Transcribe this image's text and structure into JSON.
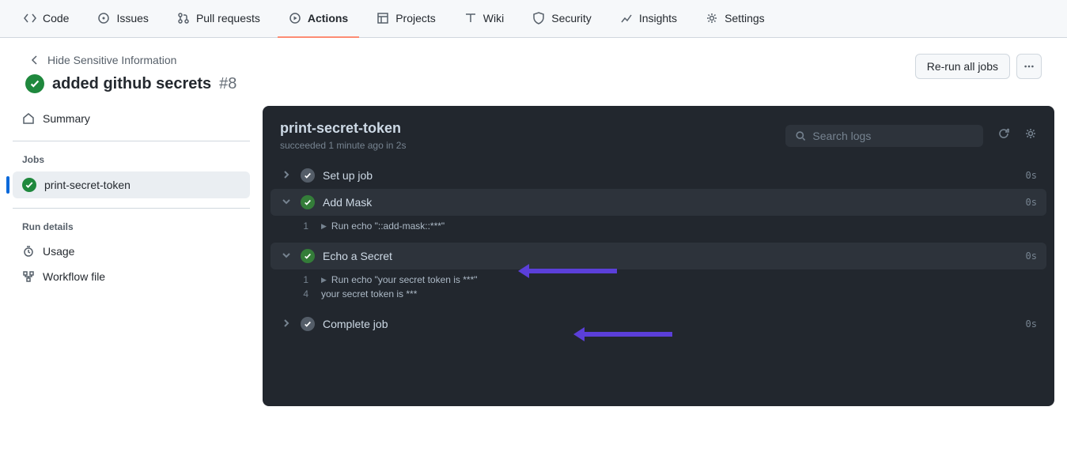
{
  "nav": {
    "items": [
      {
        "label": "Code"
      },
      {
        "label": "Issues"
      },
      {
        "label": "Pull requests"
      },
      {
        "label": "Actions"
      },
      {
        "label": "Projects"
      },
      {
        "label": "Wiki"
      },
      {
        "label": "Security"
      },
      {
        "label": "Insights"
      },
      {
        "label": "Settings"
      }
    ],
    "active_index": 3
  },
  "header": {
    "back_label": "Hide Sensitive Information",
    "run_name": "added github secrets",
    "run_number": "#8",
    "rerun_label": "Re-run all jobs"
  },
  "sidebar": {
    "summary_label": "Summary",
    "jobs_label": "Jobs",
    "jobs": [
      {
        "label": "print-secret-token"
      }
    ],
    "run_details_label": "Run details",
    "usage_label": "Usage",
    "workflow_file_label": "Workflow file"
  },
  "panel": {
    "title": "print-secret-token",
    "subtitle": "succeeded 1 minute ago in 2s",
    "search_placeholder": "Search logs"
  },
  "steps": [
    {
      "name": "Set up job",
      "duration": "0s",
      "expanded": false,
      "status": "grey",
      "lines": []
    },
    {
      "name": "Add Mask",
      "duration": "0s",
      "expanded": true,
      "status": "ok",
      "lines": [
        {
          "n": "1",
          "tri": true,
          "text": "Run echo \"::add-mask::***\""
        }
      ]
    },
    {
      "name": "Echo a Secret",
      "duration": "0s",
      "expanded": true,
      "status": "ok",
      "lines": [
        {
          "n": "1",
          "tri": true,
          "text": "Run echo \"your secret token is ***\""
        },
        {
          "n": "4",
          "tri": false,
          "text": "your secret token is ***"
        }
      ]
    },
    {
      "name": "Complete job",
      "duration": "0s",
      "expanded": false,
      "status": "grey",
      "lines": []
    }
  ]
}
